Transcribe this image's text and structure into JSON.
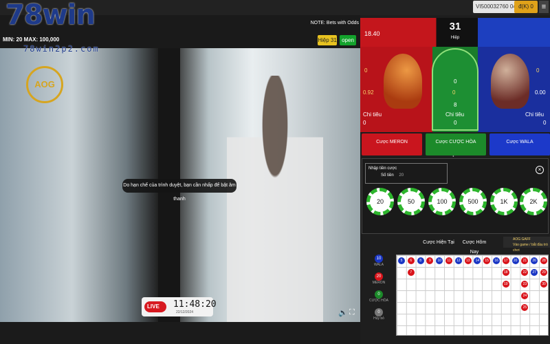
{
  "brand": {
    "logo": "78win",
    "sub": "78win2p2.com"
  },
  "user": {
    "id": "VI500032760 04",
    "balance": "đ(K) 0",
    "menu_icon": "hamburger-icon"
  },
  "video": {
    "note": "NOTE: Bets with Odds",
    "minmax": "MIN: 20 MAX: 100,000",
    "round_tag": "Hiệp 31",
    "status": "open",
    "watermark": "AOG",
    "toast": "Do hạn chế của trình duyệt, bạn cần nhấp để bật âm thanh",
    "live": "LIVE",
    "clock": "11:48:20",
    "date": "22/12/2024"
  },
  "score": {
    "meron_amount": "18.40",
    "round": "31",
    "round_label": "Hiệp"
  },
  "arena": {
    "meron": {
      "bet": "0",
      "odds": "0.92",
      "chi_tieu_label": "Chi tiêu",
      "chi_tieu": "0",
      "name": "MERON"
    },
    "hoa": {
      "top": "0",
      "bet": "0",
      "odds": "8",
      "chi_tieu_label": "Chi tiêu",
      "chi_tieu": "0",
      "name": "CƯỢC HÒA"
    },
    "wala": {
      "bet": "0",
      "odds": "0.00",
      "chi_tieu_label": "Chi tiêu",
      "chi_tieu": "0",
      "name": "WALA"
    }
  },
  "bets": {
    "meron": "Cược MERON",
    "hoa": "Cược CƯỢC HÒA",
    "wala": "Cược WALA"
  },
  "stake": {
    "label": "Nhập tiền cược",
    "amount_label": "Số tiền",
    "amount": "20",
    "chips": [
      "20",
      "50",
      "100",
      "500",
      "1K",
      "2K"
    ]
  },
  "tabs": [
    "Cược Hiện Tại",
    "Cược Hôm Nay"
  ],
  "aog_gaff": {
    "title": "AOG GAFF",
    "sub": "Vào game / bắt đầu trò chơi"
  },
  "stats": [
    {
      "value": "10",
      "label": "WALA",
      "color": "#1a36c4"
    },
    {
      "value": "20",
      "label": "MERON",
      "color": "#d9141b"
    },
    {
      "value": "0",
      "label": "CƯỢC HÒA",
      "color": "#1c8a2a"
    },
    {
      "value": "0",
      "label": "Hủy bỏ",
      "color": "#777777"
    }
  ],
  "roadmap": [
    {
      "col": 0,
      "row": 0,
      "v": "5",
      "c": "blue"
    },
    {
      "col": 1,
      "row": 0,
      "v": "6",
      "c": "red"
    },
    {
      "col": 1,
      "row": 1,
      "v": "7",
      "c": "red"
    },
    {
      "col": 2,
      "row": 0,
      "v": "8",
      "c": "blue"
    },
    {
      "col": 3,
      "row": 0,
      "v": "9",
      "c": "red"
    },
    {
      "col": 4,
      "row": 0,
      "v": "10",
      "c": "blue"
    },
    {
      "col": 5,
      "row": 0,
      "v": "11",
      "c": "red"
    },
    {
      "col": 6,
      "row": 0,
      "v": "12",
      "c": "blue"
    },
    {
      "col": 7,
      "row": 0,
      "v": "13",
      "c": "red"
    },
    {
      "col": 8,
      "row": 0,
      "v": "14",
      "c": "blue"
    },
    {
      "col": 9,
      "row": 0,
      "v": "15",
      "c": "red"
    },
    {
      "col": 10,
      "row": 0,
      "v": "16",
      "c": "blue"
    },
    {
      "col": 11,
      "row": 0,
      "v": "17",
      "c": "red"
    },
    {
      "col": 11,
      "row": 1,
      "v": "18",
      "c": "red"
    },
    {
      "col": 11,
      "row": 2,
      "v": "19",
      "c": "red"
    },
    {
      "col": 12,
      "row": 0,
      "v": "20",
      "c": "blue"
    },
    {
      "col": 13,
      "row": 0,
      "v": "21",
      "c": "red"
    },
    {
      "col": 13,
      "row": 1,
      "v": "22",
      "c": "red"
    },
    {
      "col": 13,
      "row": 2,
      "v": "23",
      "c": "red"
    },
    {
      "col": 13,
      "row": 3,
      "v": "24",
      "c": "red"
    },
    {
      "col": 13,
      "row": 4,
      "v": "25",
      "c": "red"
    },
    {
      "col": 14,
      "row": 0,
      "v": "26",
      "c": "blue"
    },
    {
      "col": 14,
      "row": 1,
      "v": "27",
      "c": "blue"
    },
    {
      "col": 15,
      "row": 0,
      "v": "28",
      "c": "red"
    },
    {
      "col": 15,
      "row": 1,
      "v": "29",
      "c": "red"
    },
    {
      "col": 15,
      "row": 2,
      "v": "30",
      "c": "red"
    }
  ]
}
